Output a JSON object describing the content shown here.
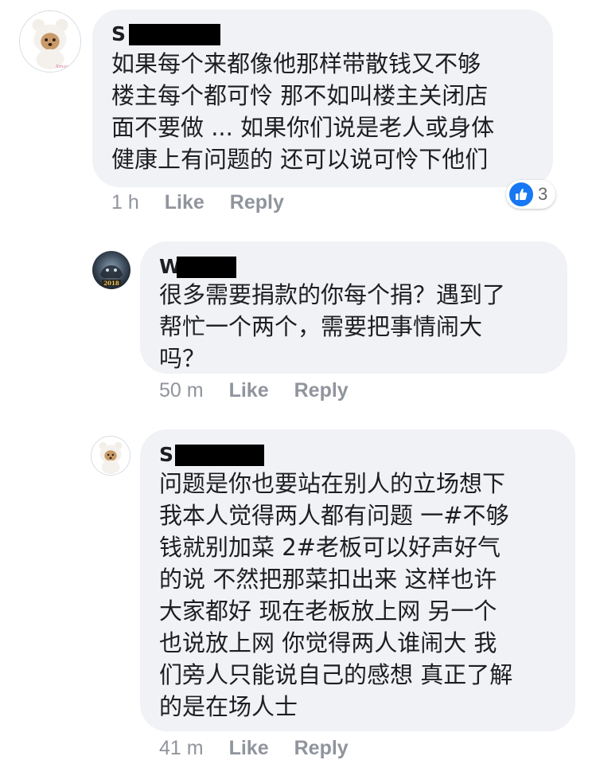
{
  "comments": [
    {
      "author_initial": "S",
      "text": "如果每个来都像他那样带散钱又不够\n楼主每个都可怜 那不如叫楼主关闭店\n面不要做 ... 如果你们说是老人或身体\n健康上有问题的 还可以说可怜下他们",
      "time": "1 h",
      "like_label": "Like",
      "reply_label": "Reply",
      "reaction_count": "3",
      "avatar_icon": "dog-in-white-bear-hoodie-icon"
    },
    {
      "author_initial": "W",
      "text": "很多需要捐款的你每个捐？遇到了\n帮忙一个两个，需要把事情闹大\n吗？",
      "time": "50 m",
      "like_label": "Like",
      "reply_label": "Reply",
      "avatar_icon": "dark-fantasy-2018-icon"
    },
    {
      "author_initial": "S",
      "text": "问题是你也要站在别人的立场想下\n我本人觉得两人都有问题 一#不够\n钱就别加菜 2#老板可以好声好气\n的说 不然把那菜扣出来 这样也许\n大家都好 现在老板放上网 另一个\n也说放上网 你觉得两人谁闹大 我\n们旁人只能说自己的感想 真正了解\n的是在场人士",
      "time": "41 m",
      "like_label": "Like",
      "reply_label": "Reply",
      "avatar_icon": "dog-in-white-bear-hoodie-icon"
    }
  ],
  "colors": {
    "bubble": "#f0f2f5",
    "meta": "#90949c",
    "like_blue": "#1877f2",
    "redaction": "#000000"
  }
}
